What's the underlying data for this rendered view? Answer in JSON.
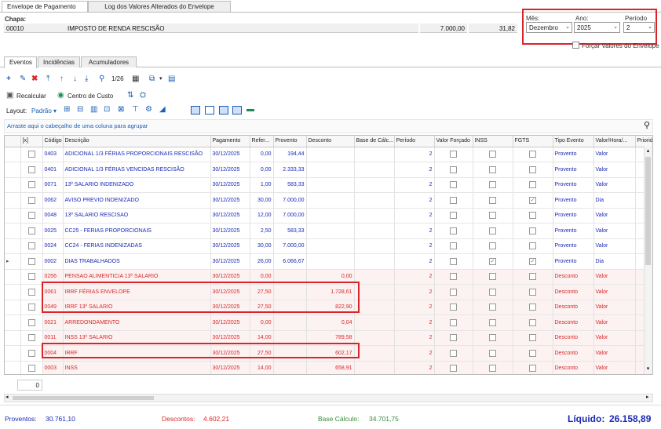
{
  "tabs_top": [
    "Envelope de Pagamento",
    "Log dos Valores Alterados do Envelope"
  ],
  "chapa_label": "Chapa:",
  "chapa_value": "00010",
  "chapa_desc": "IMPOSTO DE RENDA RESCISÃO",
  "chapa_val1": "7.000,00",
  "chapa_val2": "31,82",
  "periodo_labels": {
    "mes": "Mês:",
    "ano": "Ano:",
    "periodo": "Período"
  },
  "periodo_values": {
    "mes": "Dezembro",
    "ano": "2025",
    "periodo": "2"
  },
  "forcar_label": "Forçar Valores do Envelope",
  "sub_tabs": [
    "Eventos",
    "Incidências",
    "Acumuladores"
  ],
  "toolbar": {
    "page": "1/26",
    "recalcular": "Recalcular",
    "centro_custo": "Centro de Custo",
    "layout": "Layout:",
    "padrao": "Padrão"
  },
  "group_hint": "Arraste aqui o cabeçalho de uma coluna para agrupar",
  "columns": [
    "[x]",
    "Código",
    "Descrição",
    "Pagamento",
    "Refer...",
    "Provento",
    "Desconto",
    "Base de Cálc...",
    "Período",
    "Valor Forçado",
    "INSS",
    "FGTS",
    "Tipo Evento",
    "Valor/Hora/...",
    "Priorida"
  ],
  "rows": [
    {
      "code": "0403",
      "desc": "ADICIONAL 1/3 FÉRIAS PROPORCIONAIS RESCISÃO",
      "pag": "30/12/2025",
      "ref": "0,00",
      "prov": "194,44",
      "descv": "",
      "per": "2",
      "inss": "",
      "fgts": "",
      "tipo": "Provento",
      "vh": "Valor",
      "kind": "prov"
    },
    {
      "code": "0401",
      "desc": "ADICIONAL 1/3 FÉRIAS VENCIDAS RESCISÃO",
      "pag": "30/12/2025",
      "ref": "0,00",
      "prov": "2.333,33",
      "descv": "",
      "per": "2",
      "inss": "",
      "fgts": "",
      "tipo": "Provento",
      "vh": "Valor",
      "kind": "prov"
    },
    {
      "code": "0071",
      "desc": "13º SALARIO INDENIZADO",
      "pag": "30/12/2025",
      "ref": "1,00",
      "prov": "583,33",
      "descv": "",
      "per": "2",
      "inss": "",
      "fgts": "",
      "tipo": "Provento",
      "vh": "Valor",
      "kind": "prov"
    },
    {
      "code": "0062",
      "desc": "AVISO PREVIO INDENIZADO",
      "pag": "30/12/2025",
      "ref": "30,00",
      "prov": "7.000,00",
      "descv": "",
      "per": "2",
      "inss": "",
      "fgts": "✓",
      "tipo": "Provento",
      "vh": "Dia",
      "kind": "prov"
    },
    {
      "code": "0048",
      "desc": "13º SALARIO RESCISAO",
      "pag": "30/12/2025",
      "ref": "12,00",
      "prov": "7.000,00",
      "descv": "",
      "per": "2",
      "inss": "",
      "fgts": "",
      "tipo": "Provento",
      "vh": "Valor",
      "kind": "prov"
    },
    {
      "code": "0025",
      "desc": "CC25 - FERIAS PROPORCIONAIS",
      "pag": "30/12/2025",
      "ref": "2,50",
      "prov": "583,33",
      "descv": "",
      "per": "2",
      "inss": "",
      "fgts": "",
      "tipo": "Provento",
      "vh": "Valor",
      "kind": "prov"
    },
    {
      "code": "0024",
      "desc": "CC24 - FERIAS INDENIZADAS",
      "pag": "30/12/2025",
      "ref": "30,00",
      "prov": "7.000,00",
      "descv": "",
      "per": "2",
      "inss": "",
      "fgts": "",
      "tipo": "Provento",
      "vh": "Valor",
      "kind": "prov"
    },
    {
      "code": "0002",
      "desc": "DIAS TRABALHADOS",
      "pag": "30/12/2025",
      "ref": "26,00",
      "prov": "6.066,67",
      "descv": "",
      "per": "2",
      "inss": "✓",
      "fgts": "✓",
      "tipo": "Provento",
      "vh": "Dia",
      "kind": "prov"
    },
    {
      "code": "0256",
      "desc": "PENSAO ALIMENTICIA 13º SALARIO",
      "pag": "30/12/2025",
      "ref": "0,00",
      "prov": "",
      "descv": "0,00",
      "per": "2",
      "inss": "",
      "fgts": "",
      "tipo": "Desconto",
      "vh": "Valor",
      "kind": "desc"
    },
    {
      "code": "0061",
      "desc": "IRRF FÉRIAS ENVELOPE",
      "pag": "30/12/2025",
      "ref": "27,50",
      "prov": "",
      "descv": "1.728,61",
      "per": "2",
      "inss": "",
      "fgts": "",
      "tipo": "Desconto",
      "vh": "Valor",
      "kind": "desc"
    },
    {
      "code": "0049",
      "desc": "IRRF 13º SALARIO",
      "pag": "30/12/2025",
      "ref": "27,50",
      "prov": "",
      "descv": "822,90",
      "per": "2",
      "inss": "",
      "fgts": "",
      "tipo": "Desconto",
      "vh": "Valor",
      "kind": "desc"
    },
    {
      "code": "0021",
      "desc": "ARREDONDAMENTO",
      "pag": "30/12/2025",
      "ref": "0,00",
      "prov": "",
      "descv": "0,04",
      "per": "2",
      "inss": "",
      "fgts": "",
      "tipo": "Desconto",
      "vh": "Valor",
      "kind": "desc"
    },
    {
      "code": "0011",
      "desc": "INSS 13º SALARIO",
      "pag": "30/12/2025",
      "ref": "14,00",
      "prov": "",
      "descv": "789,58",
      "per": "2",
      "inss": "",
      "fgts": "",
      "tipo": "Desconto",
      "vh": "Valor",
      "kind": "desc"
    },
    {
      "code": "0004",
      "desc": "IRRF",
      "pag": "30/12/2025",
      "ref": "27,50",
      "prov": "",
      "descv": "602,17",
      "per": "2",
      "inss": "",
      "fgts": "",
      "tipo": "Desconto",
      "vh": "Valor",
      "kind": "desc"
    },
    {
      "code": "0003",
      "desc": "INSS",
      "pag": "30/12/2025",
      "ref": "14,00",
      "prov": "",
      "descv": "658,91",
      "per": "2",
      "inss": "",
      "fgts": "",
      "tipo": "Desconto",
      "vh": "Valor",
      "kind": "desc"
    }
  ],
  "row_count": "0",
  "footer": {
    "proventos_label": "Proventos:",
    "proventos": "30.761,10",
    "descontos_label": "Descontos:",
    "descontos": "4.602,21",
    "base_label": "Base Cálculo:",
    "base": "34.701,75",
    "liquido_label": "Líquido:",
    "liquido": "26.158,89"
  },
  "colors": {
    "provento": "#1b2ab5",
    "desconto": "#d42a2a",
    "highlight": "#d9252a",
    "liquido": "#1b2ab5"
  }
}
